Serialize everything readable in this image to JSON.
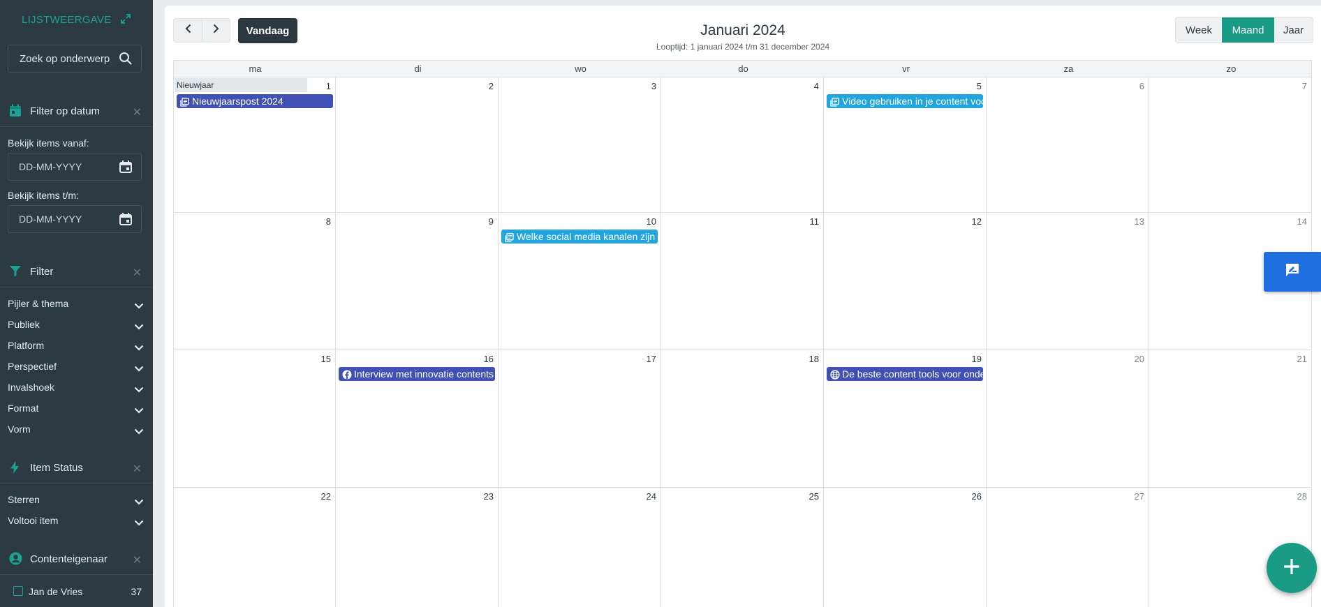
{
  "sidebar": {
    "list_view_label": "LIJSTWEERGAVE",
    "search": {
      "placeholder": "Zoek op onderwerp"
    },
    "date_filter": {
      "title": "Filter op datum",
      "from_label": "Bekijk items vanaf:",
      "from_placeholder": "DD-MM-YYYY",
      "to_label": "Bekijk items t/m:",
      "to_placeholder": "DD-MM-YYYY"
    },
    "filter": {
      "title": "Filter",
      "items": [
        "Pijler & thema",
        "Publiek",
        "Platform",
        "Perspectief",
        "Invalshoek",
        "Format",
        "Vorm"
      ]
    },
    "item_status": {
      "title": "Item Status",
      "items": [
        "Sterren",
        "Voltooi item"
      ]
    },
    "content_owner": {
      "title": "Contenteigenaar",
      "owner_name": "Jan de Vries",
      "owner_count": "37"
    }
  },
  "header": {
    "today_label": "Vandaag",
    "title": "Januari 2024",
    "subtitle": "Looptijd: 1 januari 2024 t/m 31 december 2024",
    "views": {
      "week": "Week",
      "month": "Maand",
      "year": "Jaar"
    },
    "active_view": "month"
  },
  "calendar": {
    "weekdays": [
      "ma",
      "di",
      "wo",
      "do",
      "vr",
      "za",
      "zo"
    ],
    "weeks": [
      [
        1,
        2,
        3,
        4,
        5,
        6,
        7
      ],
      [
        8,
        9,
        10,
        11,
        12,
        13,
        14
      ],
      [
        15,
        16,
        17,
        18,
        19,
        20,
        21
      ],
      [
        22,
        23,
        24,
        25,
        26,
        27,
        28
      ]
    ],
    "holiday": {
      "day": 1,
      "label": "Nieuwjaar"
    },
    "events": [
      {
        "day": 1,
        "title": "Nieuwjaarspost 2024",
        "icon": "article-icon",
        "color": "#3f51b5"
      },
      {
        "day": 5,
        "title": "Video gebruiken in je content voor",
        "icon": "article-icon",
        "color": "#20a5de"
      },
      {
        "day": 10,
        "title": "Welke social media kanalen zijn re",
        "icon": "article-icon",
        "color": "#20a5de"
      },
      {
        "day": 16,
        "title": "Interview met innovatie contents",
        "icon": "facebook-icon",
        "color": "#3f51b5"
      },
      {
        "day": 19,
        "title": "De beste content tools voor onde",
        "icon": "globe-icon",
        "color": "#3f51b5"
      }
    ]
  },
  "colors": {
    "sidebar_bg": "#2c3a42",
    "accent_teal": "#1a9b86",
    "feedback_blue": "#1f6fe0",
    "event_indigo": "#3f51b5",
    "event_sky": "#20a5de"
  }
}
